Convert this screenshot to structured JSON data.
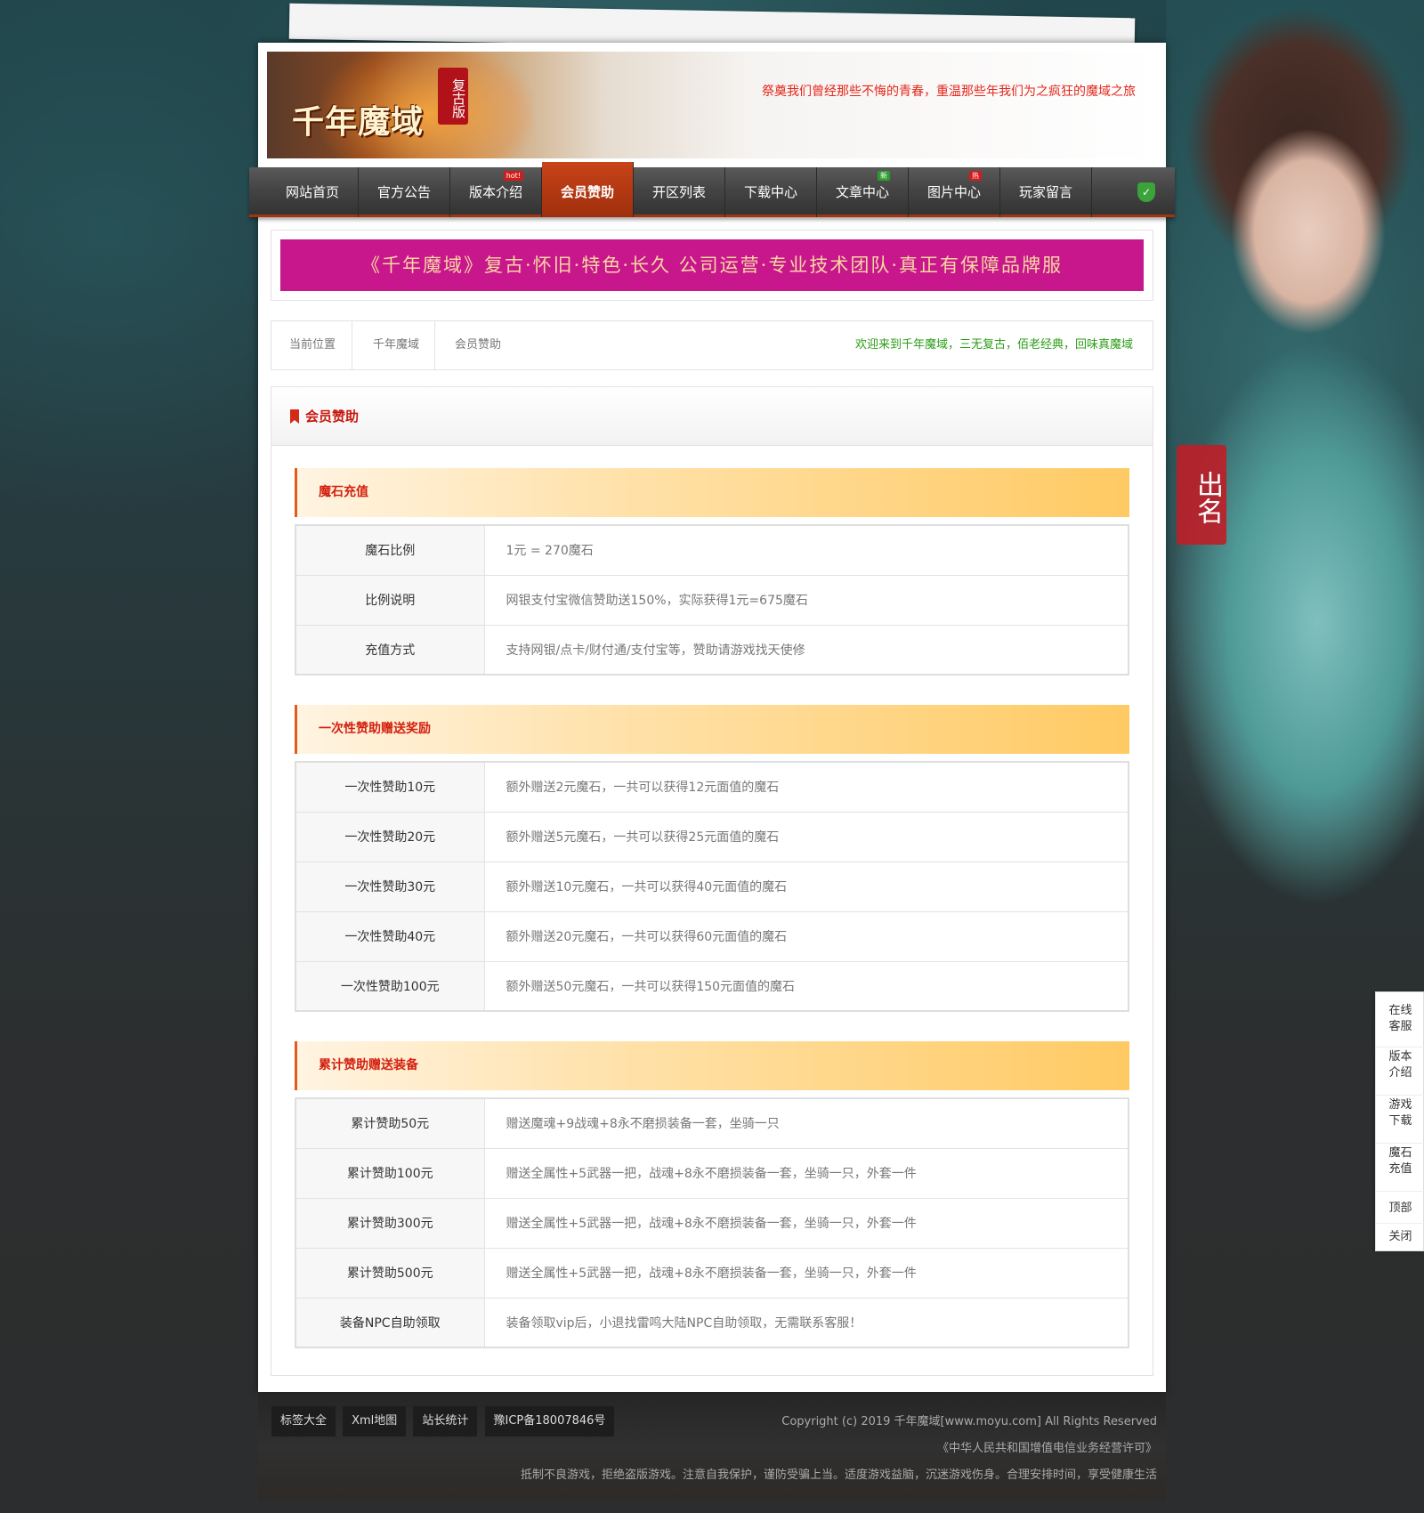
{
  "header": {
    "logo_text": "千年魔域",
    "logo_seal": "复古版",
    "slogan": "祭奠我们曾经那些不悔的青春，重温那些年我们为之疯狂的魔域之旅"
  },
  "nav": {
    "items": [
      {
        "label": "网站首页",
        "badge": ""
      },
      {
        "label": "官方公告",
        "badge": ""
      },
      {
        "label": "版本介绍",
        "badge": "hot!"
      },
      {
        "label": "会员赞助",
        "badge": ""
      },
      {
        "label": "开区列表",
        "badge": ""
      },
      {
        "label": "下载中心",
        "badge": ""
      },
      {
        "label": "文章中心",
        "badge": "新"
      },
      {
        "label": "图片中心",
        "badge": "热"
      },
      {
        "label": "玩家留言",
        "badge": ""
      }
    ],
    "active_index": 3,
    "shield_icon": "shield-icon"
  },
  "promo": {
    "text": "《千年魔域》复古·怀旧·特色·长久  公司运营·专业技术团队·真正有保障品牌服"
  },
  "breadcrumb": {
    "items": [
      "当前位置",
      "千年魔域",
      "会员赞助"
    ],
    "welcome": "欢迎来到千年魔域，三无复古，佰老经典，回味真魔域"
  },
  "panel": {
    "title": "会员赞助",
    "sections": [
      {
        "title": "魔石充值",
        "rows": [
          {
            "k": "魔石比例",
            "v": "1元 = 270魔石"
          },
          {
            "k": "比例说明",
            "v": "网银支付宝微信赞助送150%，实际获得1元=675魔石"
          },
          {
            "k": "充值方式",
            "v": "支持网银/点卡/财付通/支付宝等，赞助请游戏找天使修"
          }
        ]
      },
      {
        "title": "一次性赞助赠送奖励",
        "rows": [
          {
            "k": "一次性赞助10元",
            "v": "额外赠送2元魔石，一共可以获得12元面值的魔石"
          },
          {
            "k": "一次性赞助20元",
            "v": "额外赠送5元魔石，一共可以获得25元面值的魔石"
          },
          {
            "k": "一次性赞助30元",
            "v": "额外赠送10元魔石，一共可以获得40元面值的魔石"
          },
          {
            "k": "一次性赞助40元",
            "v": "额外赠送20元魔石，一共可以获得60元面值的魔石"
          },
          {
            "k": "一次性赞助100元",
            "v": "额外赠送50元魔石，一共可以获得150元面值的魔石"
          }
        ]
      },
      {
        "title": "累计赞助赠送装备",
        "rows": [
          {
            "k": "累计赞助50元",
            "v": "赠送魔魂+9战魂+8永不磨损装备一套，坐骑一只"
          },
          {
            "k": "累计赞助100元",
            "v": "赠送全属性+5武器一把，战魂+8永不磨损装备一套，坐骑一只，外套一件"
          },
          {
            "k": "累计赞助300元",
            "v": "赠送全属性+5武器一把，战魂+8永不磨损装备一套，坐骑一只，外套一件"
          },
          {
            "k": "累计赞助500元",
            "v": "赠送全属性+5武器一把，战魂+8永不磨损装备一套，坐骑一只，外套一件"
          },
          {
            "k": "装备NPC自助领取",
            "v": "装备领取vip后，小退找雷鸣大陆NPC自助领取，无需联系客服！"
          }
        ]
      }
    ]
  },
  "footer": {
    "links": [
      "标签大全",
      "Xml地图",
      "站长统计",
      "豫ICP备18007846号"
    ],
    "copyright": "Copyright (c) 2019 千年魔域[www.moyu.com] All Rights Reserved",
    "license": "《中华人民共和国增值电信业务经营许可》",
    "notice": "抵制不良游戏，拒绝盗版游戏。注意自我保护，谨防受骗上当。适度游戏益脑，沉迷游戏伤身。合理安排时间，享受健康生活"
  },
  "float_bar": {
    "items": [
      "在线客服",
      "版本介绍",
      "游戏下载",
      "魔石充值",
      "顶部",
      "关闭"
    ]
  },
  "side_art": {
    "seal_text": "出名"
  },
  "colors": {
    "nav_active": "#c84318",
    "promo_bg": "#c8168d",
    "section_title": "#d3200f",
    "welcome": "#2b9d15"
  }
}
